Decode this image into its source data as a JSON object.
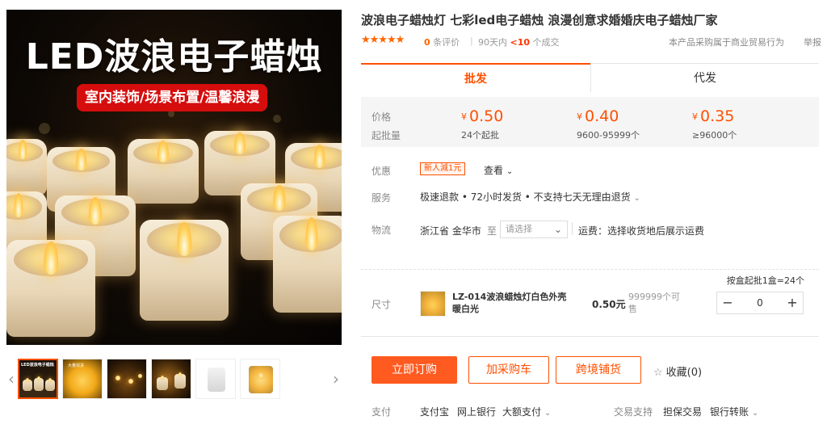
{
  "gallery": {
    "main_title": "LED波浪电子蜡烛",
    "main_tag": "室内装饰/场景布置/温馨浪漫",
    "thumb_prev": "‹",
    "thumb_next": "›",
    "thumb_text": {
      "t1": "LED波浪电子蜡烛",
      "t2": "大量现货"
    }
  },
  "product": {
    "title": "波浪电子蜡烛灯 七彩led电子蜡烛 浪漫创意求婚婚庆电子蜡烛厂家",
    "stars": "★★★★★",
    "review_count": "0",
    "review_suffix": "条评价",
    "sold_prefix": "90天内",
    "sold_count": "<10",
    "sold_suffix": "个成交",
    "notice": "本产品采购属于商业贸易行为",
    "report": "举报"
  },
  "tabs": {
    "wholesale": "批发",
    "dropship": "代发"
  },
  "pricing": {
    "price_label": "价格",
    "moq_label": "起批量",
    "currency": "¥",
    "tiers": [
      {
        "price": "0.50",
        "qty": "24个起批"
      },
      {
        "price": "0.40",
        "qty": "9600-95999个"
      },
      {
        "price": "0.35",
        "qty": "≥96000个"
      }
    ]
  },
  "promo": {
    "label": "优惠",
    "tag": "新人減1元",
    "view": "查看"
  },
  "service": {
    "label": "服务",
    "text": "极速退款 • 72小时发货 • 不支持七天无理由退货"
  },
  "logistics": {
    "label": "物流",
    "from": "浙江省 金华市",
    "to": "至",
    "select_placeholder": "请选择",
    "fee": "运费：选择收货地后展示运费"
  },
  "size": {
    "label": "尺寸",
    "batch_note": "按盒起批1盒=24个",
    "item_name": "LZ-014波浪蜡烛灯白色外壳暖白光",
    "item_price": "0.50元",
    "item_stock": "999999个可售",
    "quantity": "0",
    "minus": "−",
    "plus": "+"
  },
  "actions": {
    "buy": "立即订购",
    "cart": "加采购车",
    "cross_border": "跨境铺货",
    "favorite": "收藏(0)"
  },
  "payment": {
    "label": "支付",
    "methods": [
      "支付宝",
      "网上银行",
      "大额支付"
    ],
    "trade_label": "交易支持",
    "trade_methods": [
      "担保交易",
      "银行转账"
    ]
  },
  "colors": {
    "accent": "#ff5000",
    "buy_button": "#ff5a1f",
    "stars": "#ff6600"
  }
}
